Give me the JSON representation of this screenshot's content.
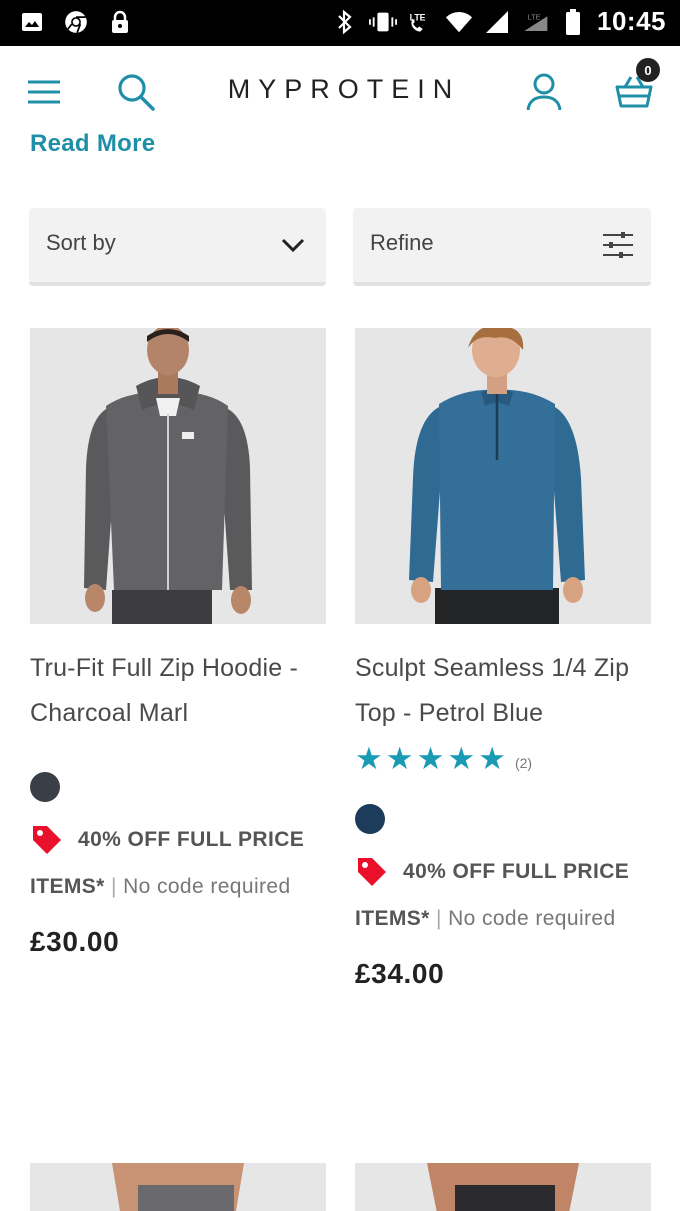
{
  "status_bar": {
    "time": "10:45",
    "left_icons": [
      "image-icon",
      "chrome-icon",
      "lock-icon"
    ],
    "right_icons": [
      "bluetooth-icon",
      "vibrate-icon",
      "lte-call-icon",
      "wifi-icon",
      "signal-icon",
      "lte-signal-icon",
      "battery-icon"
    ]
  },
  "header": {
    "logo": "MYPROTEIN",
    "cart_count": "0",
    "accent_color": "#1f8fa8"
  },
  "read_more": "Read More",
  "controls": {
    "sort_label": "Sort by",
    "refine_label": "Refine"
  },
  "products": [
    {
      "name": "Tru-Fit Full Zip Hoodie - Charcoal Marl",
      "swatch_color": "#3a3f47",
      "promo_strong": "40% OFF FULL PRICE ITEMS*",
      "promo_sep": " | ",
      "promo_rest": "No code required",
      "price": "£30.00"
    },
    {
      "name": "Sculpt Seamless 1/4 Zip Top - Petrol Blue",
      "rating": 5,
      "rating_count": "(2)",
      "swatch_color": "#1d3b5a",
      "promo_strong": "40% OFF FULL PRICE ITEMS*",
      "promo_sep": " | ",
      "promo_rest": "No code required",
      "price": "£34.00"
    }
  ]
}
